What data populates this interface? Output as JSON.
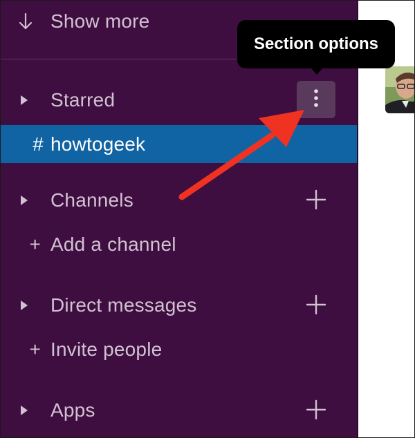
{
  "sidebar": {
    "show_more": {
      "icon": "arrow-down-icon",
      "label": "Show more"
    },
    "sections": [
      {
        "label": "Starred",
        "icon": "caret-right-icon",
        "action_icon": "kebab-icon"
      },
      {
        "label": "Channels",
        "icon": "caret-right-icon",
        "action_icon": "plus-icon"
      },
      {
        "label": "Direct messages",
        "icon": "caret-right-icon",
        "action_icon": "plus-icon"
      },
      {
        "label": "Apps",
        "icon": "caret-right-icon",
        "action_icon": "plus-icon"
      }
    ],
    "starred_channels": [
      {
        "prefix": "#",
        "label": "howtogeek",
        "selected": true
      }
    ],
    "add_channel": {
      "prefix": "+",
      "label": "Add a channel"
    },
    "invite_people": {
      "prefix": "+",
      "label": "Invite people"
    }
  },
  "tooltip": {
    "text": "Section options"
  },
  "annotation": {
    "arrow_color": "#f03222"
  },
  "colors": {
    "sidebar_bg": "#3f0e40",
    "selected_bg": "#1164a3",
    "sidebar_text": "#d1c2d2",
    "tooltip_bg": "#000000"
  }
}
